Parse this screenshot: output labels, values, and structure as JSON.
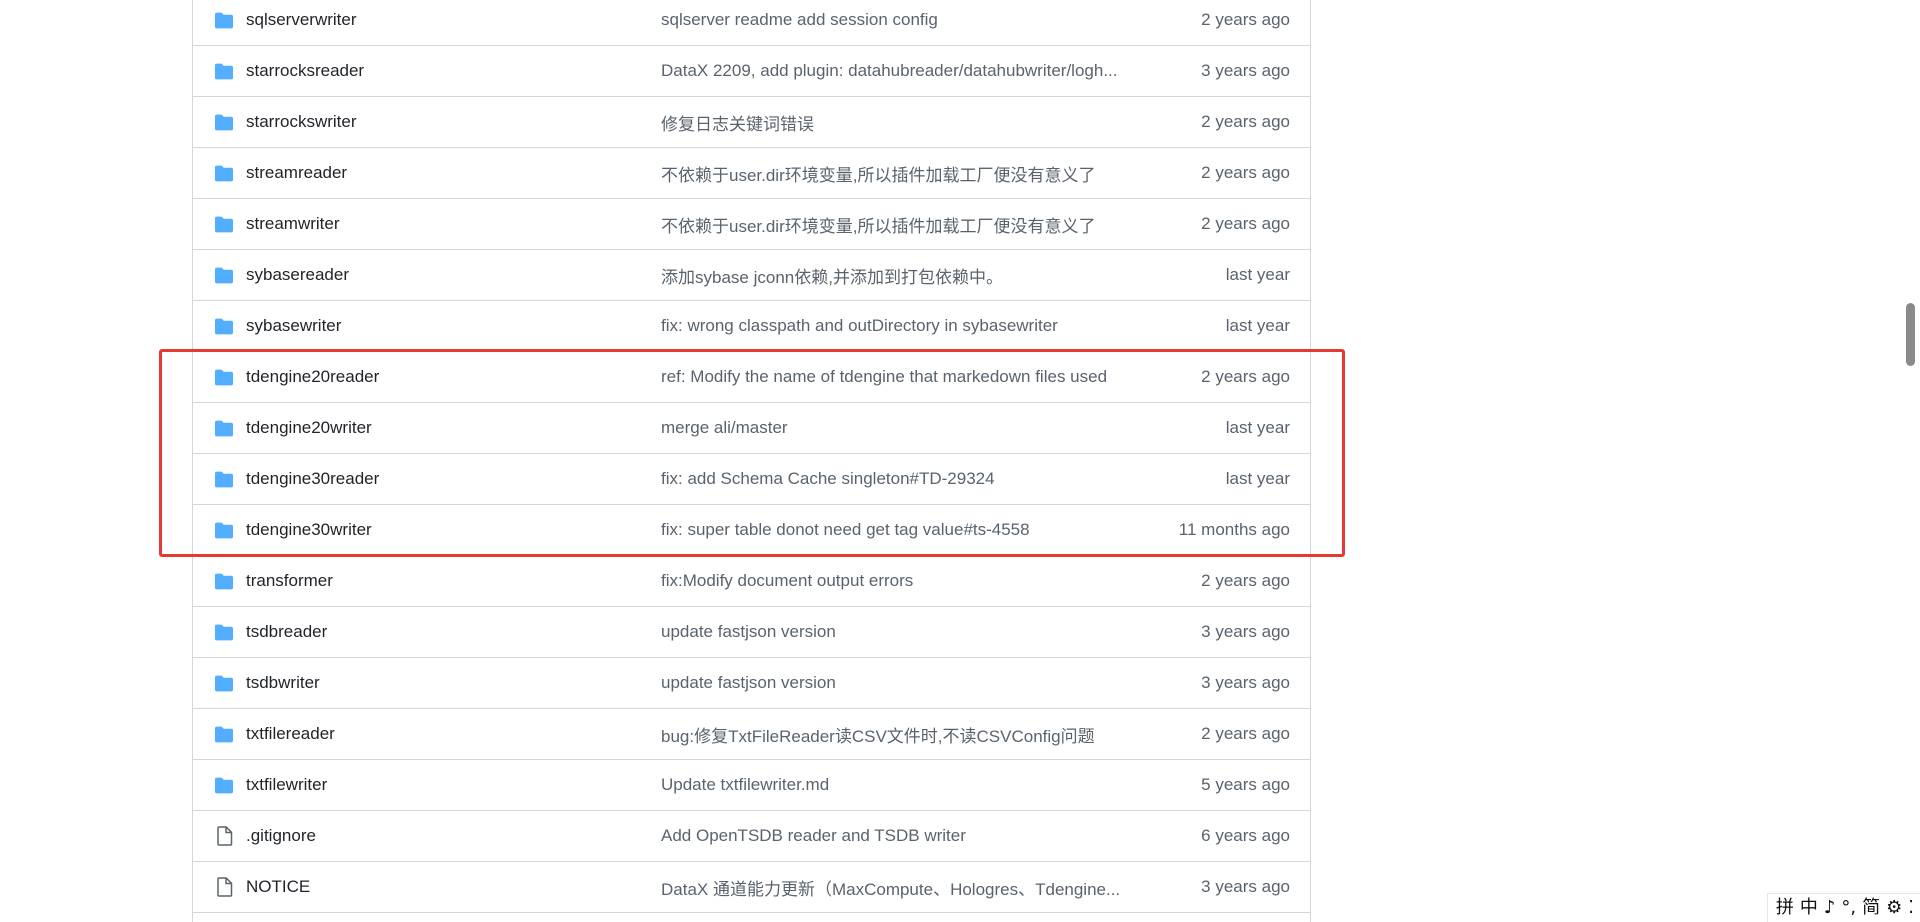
{
  "rows": [
    {
      "type": "folder-icon",
      "name": "sqlserverwriter",
      "commit": "sqlserver readme add session config",
      "age": "2 years ago"
    },
    {
      "type": "folder-icon",
      "name": "starrocksreader",
      "commit": "DataX 2209, add plugin: datahubreader/datahubwriter/logh...",
      "age": "3 years ago"
    },
    {
      "type": "folder-icon",
      "name": "starrockswriter",
      "commit": "修复日志关键词错误",
      "age": "2 years ago"
    },
    {
      "type": "folder-icon",
      "name": "streamreader",
      "commit": "不依赖于user.dir环境变量,所以插件加载工厂便没有意义了",
      "age": "2 years ago"
    },
    {
      "type": "folder-icon",
      "name": "streamwriter",
      "commit": "不依赖于user.dir环境变量,所以插件加载工厂便没有意义了",
      "age": "2 years ago"
    },
    {
      "type": "folder-icon",
      "name": "sybasereader",
      "commit": "添加sybase jconn依赖,并添加到打包依赖中。",
      "age": "last year"
    },
    {
      "type": "folder-icon",
      "name": "sybasewriter",
      "commit": "fix: wrong classpath and outDirectory in sybasewriter",
      "age": "last year"
    },
    {
      "type": "folder-icon",
      "name": "tdengine20reader",
      "commit": "ref: Modify the name of tdengine that markedown files used",
      "age": "2 years ago"
    },
    {
      "type": "folder-icon",
      "name": "tdengine20writer",
      "commit": "merge ali/master",
      "age": "last year"
    },
    {
      "type": "folder-icon",
      "name": "tdengine30reader",
      "commit": "fix: add Schema Cache singleton#TD-29324",
      "age": "last year"
    },
    {
      "type": "folder-icon",
      "name": "tdengine30writer",
      "commit": "fix: super table donot need get tag value#ts-4558",
      "age": "11 months ago"
    },
    {
      "type": "folder-icon",
      "name": "transformer",
      "commit": "fix:Modify document output errors",
      "age": "2 years ago"
    },
    {
      "type": "folder-icon",
      "name": "tsdbreader",
      "commit": "update fastjson version",
      "age": "3 years ago"
    },
    {
      "type": "folder-icon",
      "name": "tsdbwriter",
      "commit": "update fastjson version",
      "age": "3 years ago"
    },
    {
      "type": "folder-icon",
      "name": "txtfilereader",
      "commit": "bug:修复TxtFileReader读CSV文件时,不读CSVConfig问题",
      "age": "2 years ago"
    },
    {
      "type": "folder-icon",
      "name": "txtfilewriter",
      "commit": "Update txtfilewriter.md",
      "age": "5 years ago"
    },
    {
      "type": "file-icon",
      "name": ".gitignore",
      "commit": "Add OpenTSDB reader and TSDB writer",
      "age": "6 years ago"
    },
    {
      "type": "file-icon",
      "name": "NOTICE",
      "commit": "DataX 通道能力更新（MaxCompute、Hologres、Tdengine...",
      "age": "3 years ago"
    },
    {
      "type": "file-icon",
      "name": "",
      "commit": "",
      "age": ""
    }
  ],
  "ime": {
    "items": [
      "拼",
      "中",
      "♪",
      "°,",
      "简",
      "⚙",
      "⁚"
    ]
  },
  "colors": {
    "folder": "#54aeff",
    "highlight": "#e53935",
    "border": "#d0d7de",
    "muted_text": "#59636e"
  }
}
